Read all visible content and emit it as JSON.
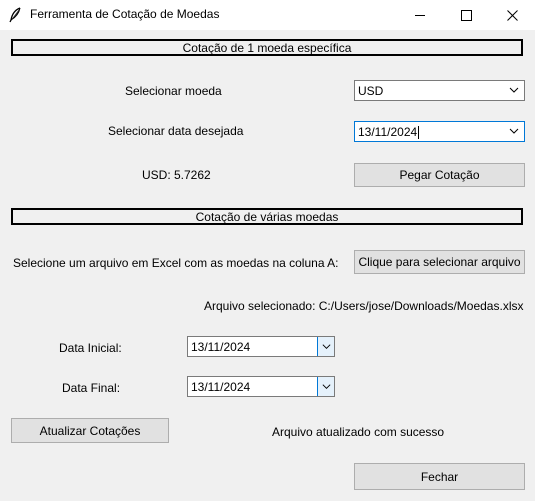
{
  "window": {
    "title": "Ferramenta de Cotação de Moedas"
  },
  "single": {
    "section_title": "Cotação de 1 moeda específica",
    "currency_label": "Selecionar moeda",
    "currency_value": "USD",
    "date_label": "Selecionar data desejada",
    "date_value": "13/11/2024",
    "result_text": "USD: 5.7262",
    "get_quote_button": "Pegar Cotação"
  },
  "multi": {
    "section_title": "Cotação de várias moedas",
    "file_prompt": "Selecione um arquivo em Excel com as moedas na coluna A:",
    "select_file_button": "Clique para selecionar arquivo",
    "selected_file_text": "Arquivo selecionado: C:/Users/jose/Downloads/Moedas.xlsx",
    "start_date_label": "Data Inicial:",
    "start_date_value": "13/11/2024",
    "end_date_label": "Data Final:",
    "end_date_value": "13/11/2024",
    "update_button": "Atualizar Cotações",
    "status_text": "Arquivo atualizado com sucesso",
    "close_button": "Fechar"
  },
  "icons": {
    "app": "feather-icon",
    "minimize": "minimize-icon",
    "maximize": "maximize-icon",
    "close": "close-icon",
    "dropdown": "chevron-down-icon"
  },
  "colors": {
    "focus_border": "#0078d7",
    "button_bg": "#e1e1e1",
    "window_bg": "#f0f0f0"
  }
}
